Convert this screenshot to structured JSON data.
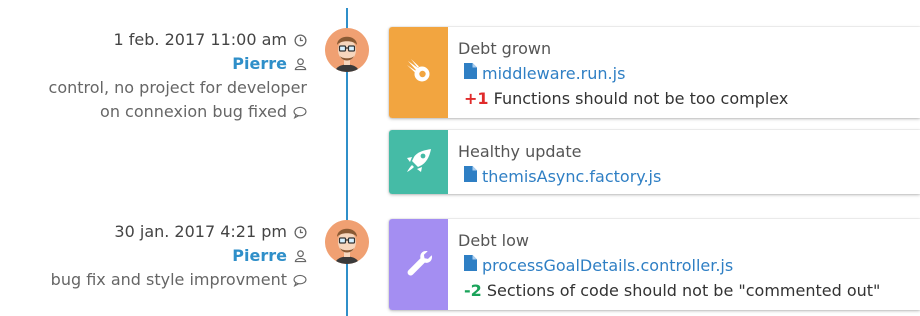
{
  "commits": [
    {
      "date": "1 feb. 2017 11:00 am",
      "author": "Pierre",
      "message_line1": "control, no project for developer",
      "message_line2": "on connexion bug fixed",
      "avatar": "developer-avatar"
    },
    {
      "date": "30 jan. 2017 4:21 pm",
      "author": "Pierre",
      "message_line1": "bug fix and style improvment",
      "avatar": "developer-avatar"
    }
  ],
  "cards": [
    {
      "title": "Debt grown",
      "color": "#f2a540",
      "icon": "meteor-icon",
      "file": "middleware.run.js",
      "delta": "+1",
      "issue": "Functions should not be too complex"
    },
    {
      "title": "Healthy update",
      "color": "#45bba6",
      "icon": "rocket-icon",
      "file": "themisAsync.factory.js"
    },
    {
      "title": "Debt low",
      "color": "#a48ef2",
      "icon": "wrench-icon",
      "file": "processGoalDetails.controller.js",
      "delta": "-2",
      "issue": "Sections of code should not be \"commented out\""
    }
  ],
  "colors": {
    "timeline": "#2f8fc9",
    "author": "#2f8fc9",
    "file": "#2f7fc4",
    "positive_delta": "#e02b2b",
    "negative_delta": "#1aa35a"
  }
}
